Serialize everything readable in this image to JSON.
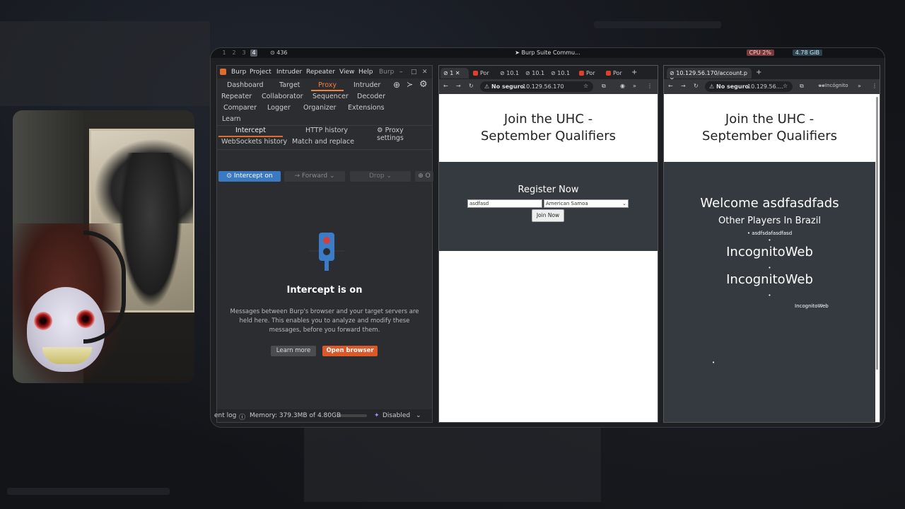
{
  "system": {
    "workspaces": [
      "1",
      "2",
      "3",
      "4"
    ],
    "active_workspace": "4",
    "window_count": "436",
    "window_title": "Burp Suite Commu...",
    "cpu": "CPU 2%",
    "memory": "4.78 GiB"
  },
  "burp": {
    "menu": [
      "Burp",
      "Project",
      "Intruder",
      "Repeater",
      "View",
      "Help",
      "Burp"
    ],
    "tabs_row1": [
      "Dashboard",
      "Target",
      "Proxy",
      "Intruder"
    ],
    "tabs_row2": [
      "Repeater",
      "Collaborator",
      "Sequencer",
      "Decoder"
    ],
    "tabs_row3": [
      "Comparer",
      "Logger",
      "Organizer",
      "Extensions"
    ],
    "tabs_row4": [
      "Learn"
    ],
    "active_tab": "Proxy",
    "subtabs": [
      "Intercept",
      "HTTP history",
      "Proxy settings",
      "WebSockets history",
      "Match and replace"
    ],
    "intercept_btn": "Intercept on",
    "forward_btn": "Forward",
    "drop_btn": "Drop",
    "open_btn": "O",
    "heading": "Intercept is on",
    "description": "Messages between Burp's browser and your target servers are held here. This enables you to analyze and modify these messages, before you forward them.",
    "learn_more": "Learn more",
    "open_browser": "Open browser",
    "status_log": "ent log",
    "status_memory": "Memory: 379.3MB of 4.80GB",
    "memory_fraction": 0.08,
    "status_ai": "Disabled"
  },
  "browser1": {
    "tabs": [
      "1",
      "Por",
      "10.1",
      "10.1",
      "10.1",
      "Por",
      "Por"
    ],
    "insecure": "No seguro",
    "url": "10.129.56.170",
    "title_line1": "Join the UHC -",
    "title_line2": "September Qualifiers",
    "register_title": "Register Now",
    "username_value": "asdfasd",
    "country_value": "American Samoa",
    "join_btn": "Join Now"
  },
  "browser2": {
    "tab_title": "10.129.56.170/account.p",
    "insecure": "No seguro",
    "url": "10.129.56....",
    "incognito": "Incógnito",
    "title_line1": "Join the UHC -",
    "title_line2": "September Qualifiers",
    "welcome": "Welcome asdfasdfads",
    "other_players": "Other Players In Brazil",
    "player1": "asdfsdafasdfasd",
    "player2": "IncognitoWeb",
    "player3": "IncognitoWeb",
    "player4": "IncognitoWeb"
  }
}
